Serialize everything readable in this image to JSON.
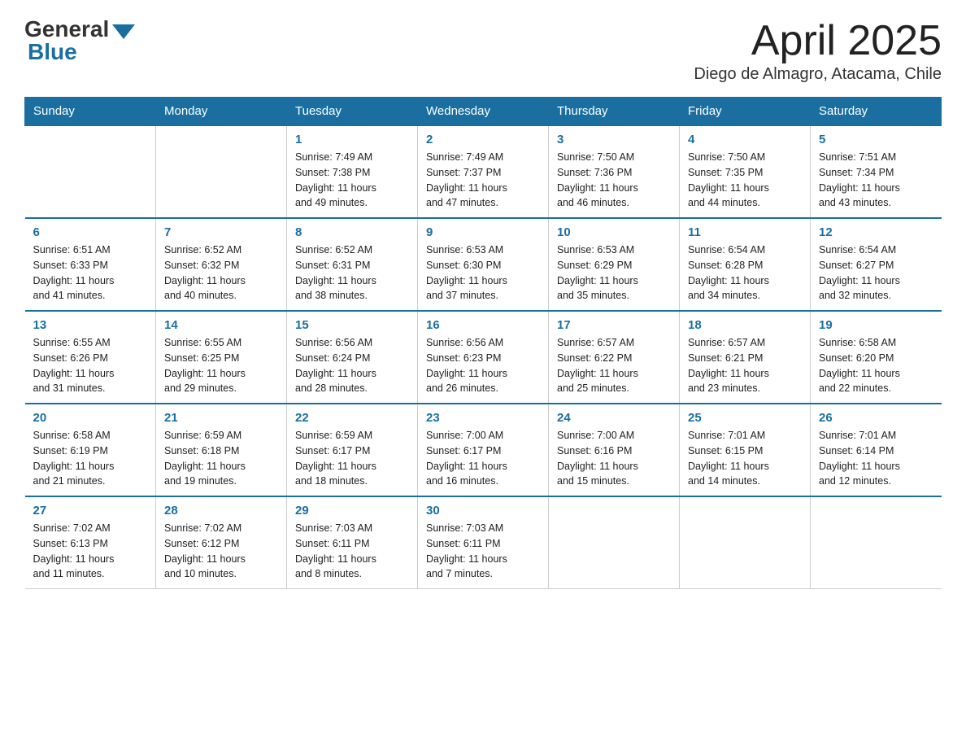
{
  "logo": {
    "general": "General",
    "blue": "Blue"
  },
  "header": {
    "month": "April 2025",
    "location": "Diego de Almagro, Atacama, Chile"
  },
  "weekdays": [
    "Sunday",
    "Monday",
    "Tuesday",
    "Wednesday",
    "Thursday",
    "Friday",
    "Saturday"
  ],
  "weeks": [
    [
      {
        "day": "",
        "info": ""
      },
      {
        "day": "",
        "info": ""
      },
      {
        "day": "1",
        "info": "Sunrise: 7:49 AM\nSunset: 7:38 PM\nDaylight: 11 hours\nand 49 minutes."
      },
      {
        "day": "2",
        "info": "Sunrise: 7:49 AM\nSunset: 7:37 PM\nDaylight: 11 hours\nand 47 minutes."
      },
      {
        "day": "3",
        "info": "Sunrise: 7:50 AM\nSunset: 7:36 PM\nDaylight: 11 hours\nand 46 minutes."
      },
      {
        "day": "4",
        "info": "Sunrise: 7:50 AM\nSunset: 7:35 PM\nDaylight: 11 hours\nand 44 minutes."
      },
      {
        "day": "5",
        "info": "Sunrise: 7:51 AM\nSunset: 7:34 PM\nDaylight: 11 hours\nand 43 minutes."
      }
    ],
    [
      {
        "day": "6",
        "info": "Sunrise: 6:51 AM\nSunset: 6:33 PM\nDaylight: 11 hours\nand 41 minutes."
      },
      {
        "day": "7",
        "info": "Sunrise: 6:52 AM\nSunset: 6:32 PM\nDaylight: 11 hours\nand 40 minutes."
      },
      {
        "day": "8",
        "info": "Sunrise: 6:52 AM\nSunset: 6:31 PM\nDaylight: 11 hours\nand 38 minutes."
      },
      {
        "day": "9",
        "info": "Sunrise: 6:53 AM\nSunset: 6:30 PM\nDaylight: 11 hours\nand 37 minutes."
      },
      {
        "day": "10",
        "info": "Sunrise: 6:53 AM\nSunset: 6:29 PM\nDaylight: 11 hours\nand 35 minutes."
      },
      {
        "day": "11",
        "info": "Sunrise: 6:54 AM\nSunset: 6:28 PM\nDaylight: 11 hours\nand 34 minutes."
      },
      {
        "day": "12",
        "info": "Sunrise: 6:54 AM\nSunset: 6:27 PM\nDaylight: 11 hours\nand 32 minutes."
      }
    ],
    [
      {
        "day": "13",
        "info": "Sunrise: 6:55 AM\nSunset: 6:26 PM\nDaylight: 11 hours\nand 31 minutes."
      },
      {
        "day": "14",
        "info": "Sunrise: 6:55 AM\nSunset: 6:25 PM\nDaylight: 11 hours\nand 29 minutes."
      },
      {
        "day": "15",
        "info": "Sunrise: 6:56 AM\nSunset: 6:24 PM\nDaylight: 11 hours\nand 28 minutes."
      },
      {
        "day": "16",
        "info": "Sunrise: 6:56 AM\nSunset: 6:23 PM\nDaylight: 11 hours\nand 26 minutes."
      },
      {
        "day": "17",
        "info": "Sunrise: 6:57 AM\nSunset: 6:22 PM\nDaylight: 11 hours\nand 25 minutes."
      },
      {
        "day": "18",
        "info": "Sunrise: 6:57 AM\nSunset: 6:21 PM\nDaylight: 11 hours\nand 23 minutes."
      },
      {
        "day": "19",
        "info": "Sunrise: 6:58 AM\nSunset: 6:20 PM\nDaylight: 11 hours\nand 22 minutes."
      }
    ],
    [
      {
        "day": "20",
        "info": "Sunrise: 6:58 AM\nSunset: 6:19 PM\nDaylight: 11 hours\nand 21 minutes."
      },
      {
        "day": "21",
        "info": "Sunrise: 6:59 AM\nSunset: 6:18 PM\nDaylight: 11 hours\nand 19 minutes."
      },
      {
        "day": "22",
        "info": "Sunrise: 6:59 AM\nSunset: 6:17 PM\nDaylight: 11 hours\nand 18 minutes."
      },
      {
        "day": "23",
        "info": "Sunrise: 7:00 AM\nSunset: 6:17 PM\nDaylight: 11 hours\nand 16 minutes."
      },
      {
        "day": "24",
        "info": "Sunrise: 7:00 AM\nSunset: 6:16 PM\nDaylight: 11 hours\nand 15 minutes."
      },
      {
        "day": "25",
        "info": "Sunrise: 7:01 AM\nSunset: 6:15 PM\nDaylight: 11 hours\nand 14 minutes."
      },
      {
        "day": "26",
        "info": "Sunrise: 7:01 AM\nSunset: 6:14 PM\nDaylight: 11 hours\nand 12 minutes."
      }
    ],
    [
      {
        "day": "27",
        "info": "Sunrise: 7:02 AM\nSunset: 6:13 PM\nDaylight: 11 hours\nand 11 minutes."
      },
      {
        "day": "28",
        "info": "Sunrise: 7:02 AM\nSunset: 6:12 PM\nDaylight: 11 hours\nand 10 minutes."
      },
      {
        "day": "29",
        "info": "Sunrise: 7:03 AM\nSunset: 6:11 PM\nDaylight: 11 hours\nand 8 minutes."
      },
      {
        "day": "30",
        "info": "Sunrise: 7:03 AM\nSunset: 6:11 PM\nDaylight: 11 hours\nand 7 minutes."
      },
      {
        "day": "",
        "info": ""
      },
      {
        "day": "",
        "info": ""
      },
      {
        "day": "",
        "info": ""
      }
    ]
  ]
}
